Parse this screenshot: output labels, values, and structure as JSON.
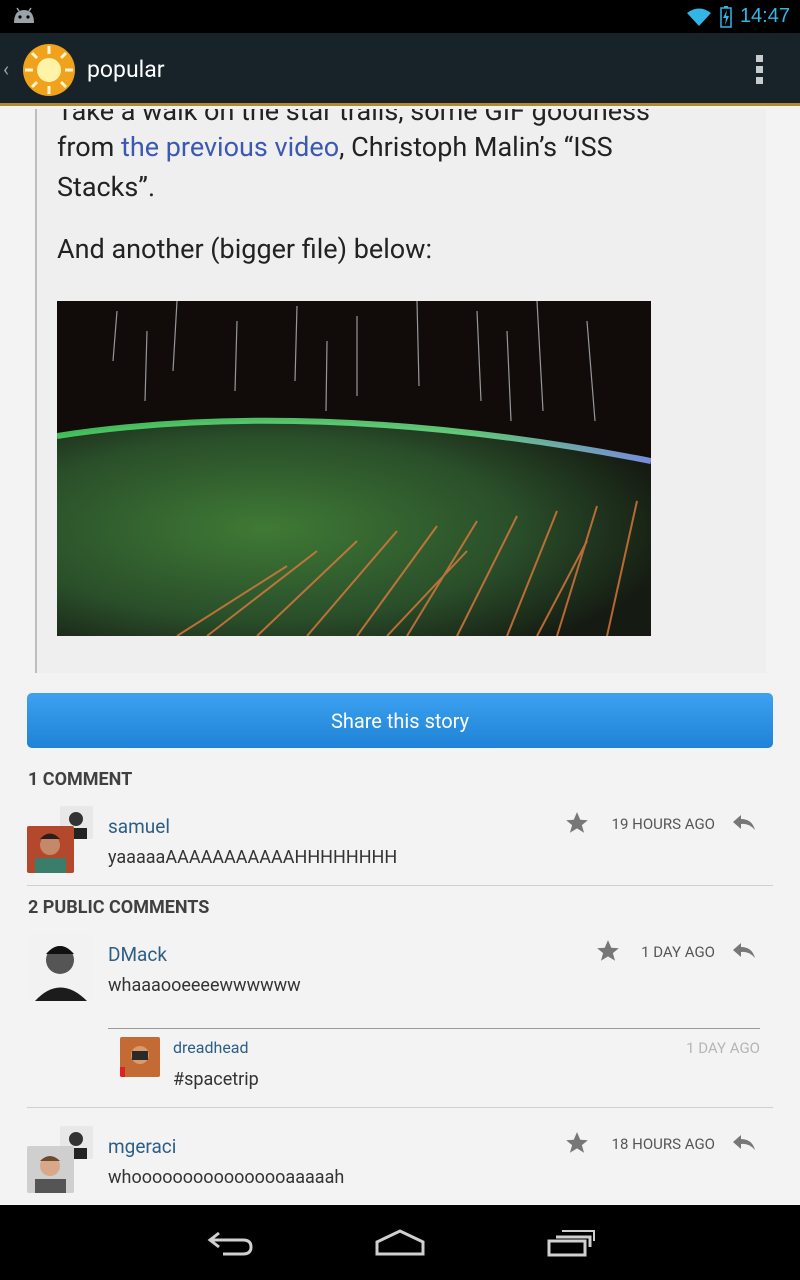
{
  "status_bar": {
    "time": "14:47"
  },
  "action_bar": {
    "title": "popular"
  },
  "story": {
    "cut_line": "Take a walk on the star trails, some GIF goodness",
    "para1_prefix": "from ",
    "para1_link": "the previous video",
    "para1_suffix": ", Christoph Malin’s “ISS Stacks”.",
    "para2": "And another (bigger file) below:"
  },
  "share_button": {
    "label": "Share this story"
  },
  "comments_header": "1 COMMENT",
  "comments": [
    {
      "user": "samuel",
      "text": "yaaaaaAAAAAAAAAAAHHHHHHHH",
      "time": "19 HOURS AGO"
    }
  ],
  "public_header": "2 PUBLIC COMMENTS",
  "public_comments": [
    {
      "user": "DMack",
      "text": "whaaaooeeeewwwwww",
      "time": "1 DAY AGO",
      "reply": {
        "user": "dreadhead",
        "text": "#spacetrip",
        "time": "1 DAY AGO"
      }
    },
    {
      "user": "mgeraci",
      "text": "whoooooooooooooooaaaaah",
      "time": "18 HOURS AGO"
    }
  ],
  "colors": {
    "accent": "#33b5e5",
    "action_bar": "#172328",
    "share": "#2a8ee4",
    "username": "#2d5f86"
  }
}
